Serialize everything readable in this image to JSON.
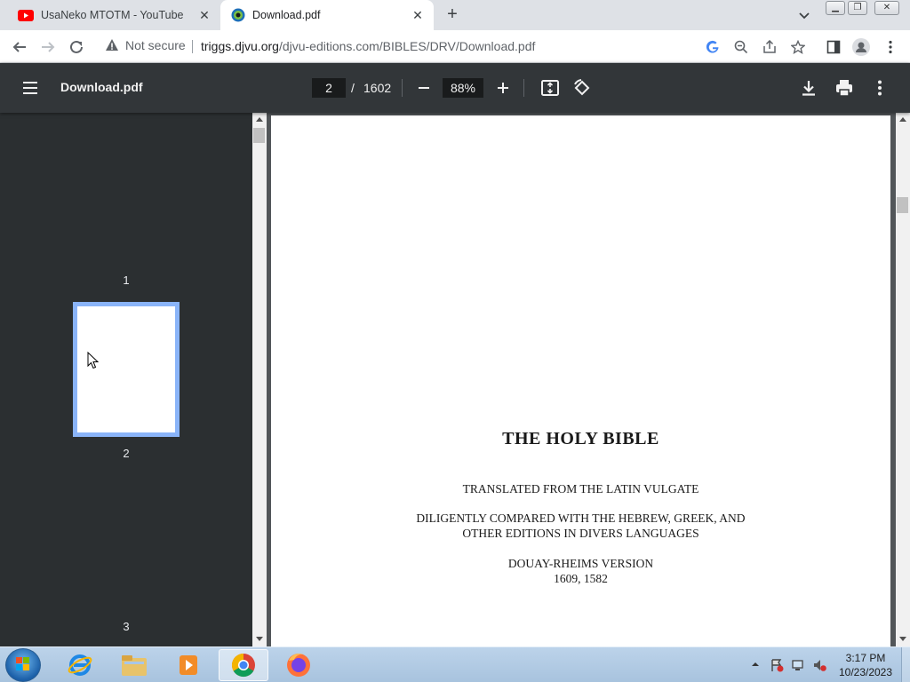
{
  "browser": {
    "tabs": [
      {
        "title": "UsaNeko MTOTM - YouTube",
        "icon": "youtube-icon",
        "active": false
      },
      {
        "title": "Download.pdf",
        "icon": "pdf-favicon",
        "active": true
      }
    ],
    "new_tab_label": "+",
    "security_label": "Not secure",
    "url_host": "triggs.djvu.org",
    "url_path": "/djvu-editions.com/BIBLES/DRV/Download.pdf"
  },
  "pdf_viewer": {
    "title": "Download.pdf",
    "current_page": "2",
    "page_separator": "/",
    "total_pages": "1602",
    "zoom": "88%"
  },
  "sidebar": {
    "thumbnails": [
      {
        "label": "1"
      },
      {
        "label": "2",
        "selected": true
      },
      {
        "label": "3"
      }
    ]
  },
  "document": {
    "title": "THE HOLY BIBLE",
    "line1": "TRANSLATED FROM THE LATIN VULGATE",
    "line2": "DILIGENTLY COMPARED WITH THE HEBREW, GREEK, AND",
    "line3": "OTHER EDITIONS IN DIVERS LANGUAGES",
    "line4": "DOUAY-RHEIMS VERSION",
    "line5": "1609, 1582"
  },
  "taskbar": {
    "time": "3:17 PM",
    "date": "10/23/2023",
    "apps": [
      "internet-explorer-icon",
      "file-explorer-icon",
      "media-player-icon",
      "chrome-icon",
      "firefox-icon"
    ]
  },
  "colors": {
    "pdf_toolbar": "#323639",
    "sidebar": "#2b2f31",
    "viewer_bg": "#525659",
    "selection": "#8ab4f8"
  }
}
